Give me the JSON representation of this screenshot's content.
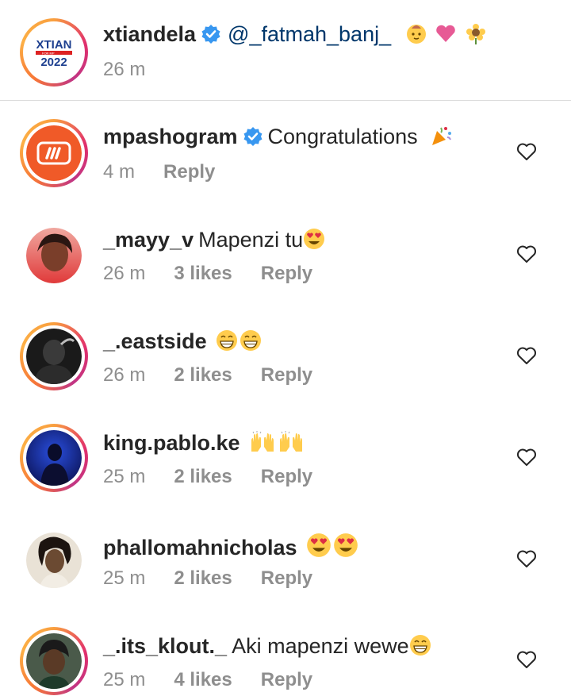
{
  "caption": {
    "username": "xtiandela",
    "mention": "@_fatmah_banj_",
    "time": "26 m",
    "logo_lines": [
      "XTIAN",
      "FOR MP",
      "2022"
    ],
    "emojis": [
      "baby-emoji",
      "heart-emoji",
      "sunflower-emoji"
    ]
  },
  "comments": [
    {
      "username": "mpashogram",
      "verified": true,
      "text": "Congratulations",
      "emojis": [
        "party-popper-emoji"
      ],
      "time": "4 m",
      "likes": "",
      "reply": "Reply"
    },
    {
      "username": "_mayy_v",
      "verified": false,
      "text": "Mapenzi tu",
      "emojis": [
        "heart-eyes-emoji"
      ],
      "time": "26 m",
      "likes": "3 likes",
      "reply": "Reply"
    },
    {
      "username": "_.eastside",
      "verified": false,
      "text": "",
      "emojis": [
        "grinning-emoji",
        "grinning-emoji"
      ],
      "time": "26 m",
      "likes": "2 likes",
      "reply": "Reply"
    },
    {
      "username": "king.pablo.ke",
      "verified": false,
      "text": "",
      "emojis": [
        "raising-hands-emoji",
        "raising-hands-emoji"
      ],
      "time": "25 m",
      "likes": "2 likes",
      "reply": "Reply"
    },
    {
      "username": "phallomahnicholas",
      "verified": false,
      "text": "",
      "emojis": [
        "heart-eyes-emoji",
        "heart-eyes-emoji"
      ],
      "time": "25 m",
      "likes": "2 likes",
      "reply": "Reply"
    },
    {
      "username": "_.its_klout._",
      "verified": false,
      "text": "Aki mapenzi wewe",
      "emojis": [
        "grinning-emoji"
      ],
      "time": "25 m",
      "likes": "4 likes",
      "reply": "Reply"
    }
  ],
  "colors": {
    "verified": "#3897f0",
    "mention": "#00376b",
    "muted": "#8e8e8e",
    "mpasho": "#f05a28"
  }
}
